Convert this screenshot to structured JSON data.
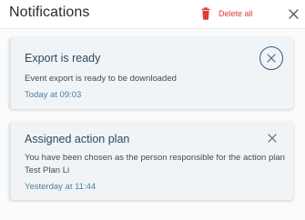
{
  "header": {
    "title": "Notifications",
    "delete_all_label": "Delete all"
  },
  "colors": {
    "accent_red": "#e03a3a",
    "title_navy": "#2d4a61",
    "time_blue": "#4f7ea0",
    "card_bg": "#f1f4f7"
  },
  "icons": {
    "delete": "trash-icon",
    "close": "close-icon"
  },
  "notifications": [
    {
      "title": "Export is ready",
      "body": "Event export is ready to be downloaded",
      "time": "Today at 09:03",
      "focused_close": true
    },
    {
      "title": "Assigned action plan",
      "body": "You have been chosen as the person responsible for the action plan Test Plan Li",
      "time": "Yesterday at 11:44",
      "focused_close": false
    }
  ]
}
